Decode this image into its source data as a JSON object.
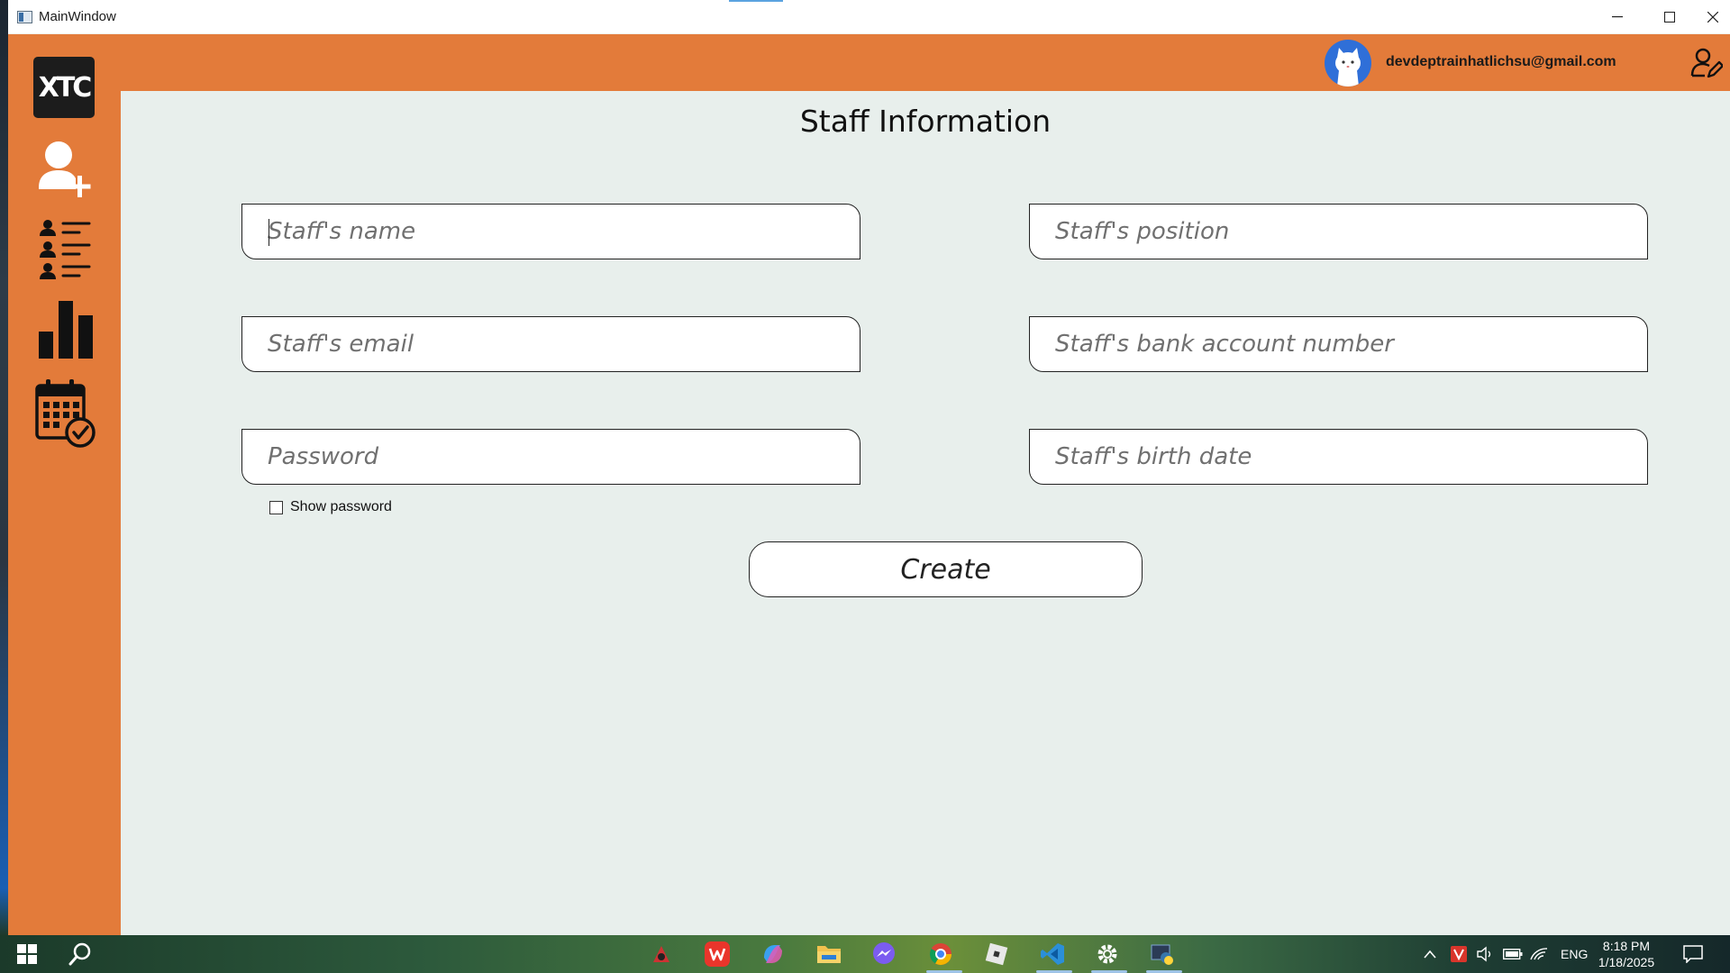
{
  "window": {
    "title": "MainWindow"
  },
  "sidebar": {
    "logo_text": "XTC",
    "items": [
      {
        "name": "add-staff",
        "icon": "user-plus-icon"
      },
      {
        "name": "staff-list",
        "icon": "user-list-icon"
      },
      {
        "name": "statistics",
        "icon": "bar-chart-icon"
      },
      {
        "name": "schedule",
        "icon": "calendar-check-icon"
      }
    ]
  },
  "header": {
    "email": "devdeptrainhatlichsu@gmail.com",
    "avatar_icon": "cat-avatar-icon",
    "edit_profile_icon": "user-edit-icon"
  },
  "form": {
    "title": "Staff Information",
    "fields": {
      "name": {
        "placeholder": "Staff's name",
        "value": ""
      },
      "position": {
        "placeholder": "Staff's position",
        "value": ""
      },
      "email": {
        "placeholder": "Staff's email",
        "value": ""
      },
      "bank": {
        "placeholder": "Staff's bank account number",
        "value": ""
      },
      "password": {
        "placeholder": "Password",
        "value": ""
      },
      "birth": {
        "placeholder": "Staff's birth date",
        "value": ""
      }
    },
    "show_password_label": "Show password",
    "show_password_checked": false,
    "create_label": "Create"
  },
  "taskbar": {
    "language": "ENG",
    "time": "8:18 PM",
    "date": "1/18/2025"
  },
  "colors": {
    "accent": "#e37b3a",
    "background": "#e8efec"
  }
}
